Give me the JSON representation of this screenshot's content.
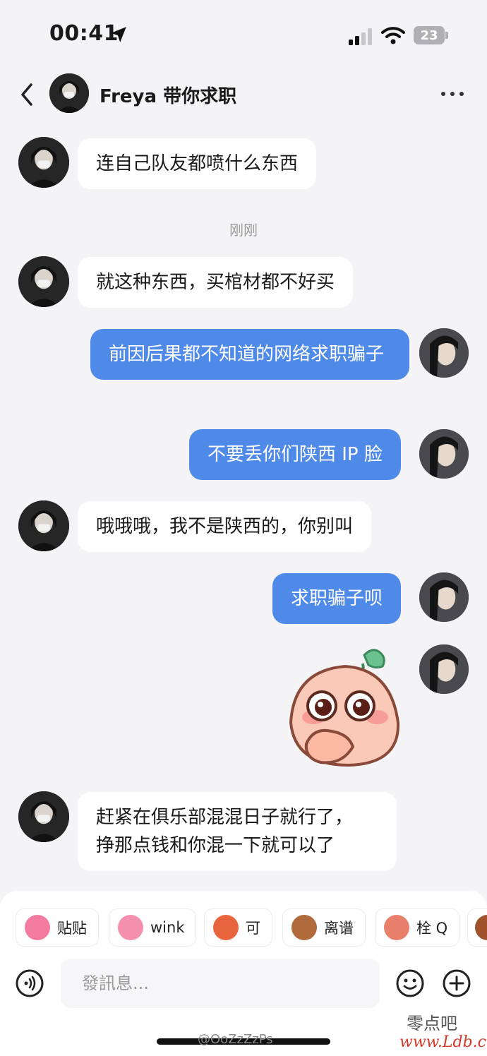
{
  "status_bar": {
    "time": "00:41",
    "battery": "23"
  },
  "header": {
    "title": "Freya 带你求职"
  },
  "messages": [
    {
      "side": "in",
      "text": "连自己队友都喷什么东西"
    },
    {
      "side": "in",
      "text": "就这种东西，买棺材都不好买"
    },
    {
      "side": "out",
      "text": "前因后果都不知道的网络求职骗子"
    },
    {
      "side": "out",
      "text": "不要丢你们陕西 IP 脸"
    },
    {
      "side": "in",
      "text": "哦哦哦，我不是陕西的，你别叫"
    },
    {
      "side": "out",
      "text": "求职骗子呗"
    },
    {
      "side": "out",
      "type": "sticker",
      "sticker": "peach-blush-sticker"
    },
    {
      "side": "in",
      "line1": "赶紧在俱乐部混混日子就行了，",
      "line2": "挣那点钱和你混一下就可以了"
    }
  ],
  "timestamp": "刚刚",
  "stickers": [
    {
      "label": "贴贴",
      "color": "#f47ba0"
    },
    {
      "label": "wink",
      "color": "#f58fae"
    },
    {
      "label": "可",
      "color": "#e8643c"
    },
    {
      "label": "离谱",
      "color": "#b06a3c"
    },
    {
      "label": "栓 Q",
      "color": "#e77f6b"
    }
  ],
  "composer": {
    "placeholder": "發訊息..."
  },
  "watermarks": {
    "weibo": "@OoZzZzPs",
    "site": "零点吧",
    "url": "www.Ldb.cc"
  },
  "colors": {
    "outgoing_bubble": "#4f8ae8",
    "incoming_bubble": "#ffffff",
    "background": "#f4f4f6"
  }
}
